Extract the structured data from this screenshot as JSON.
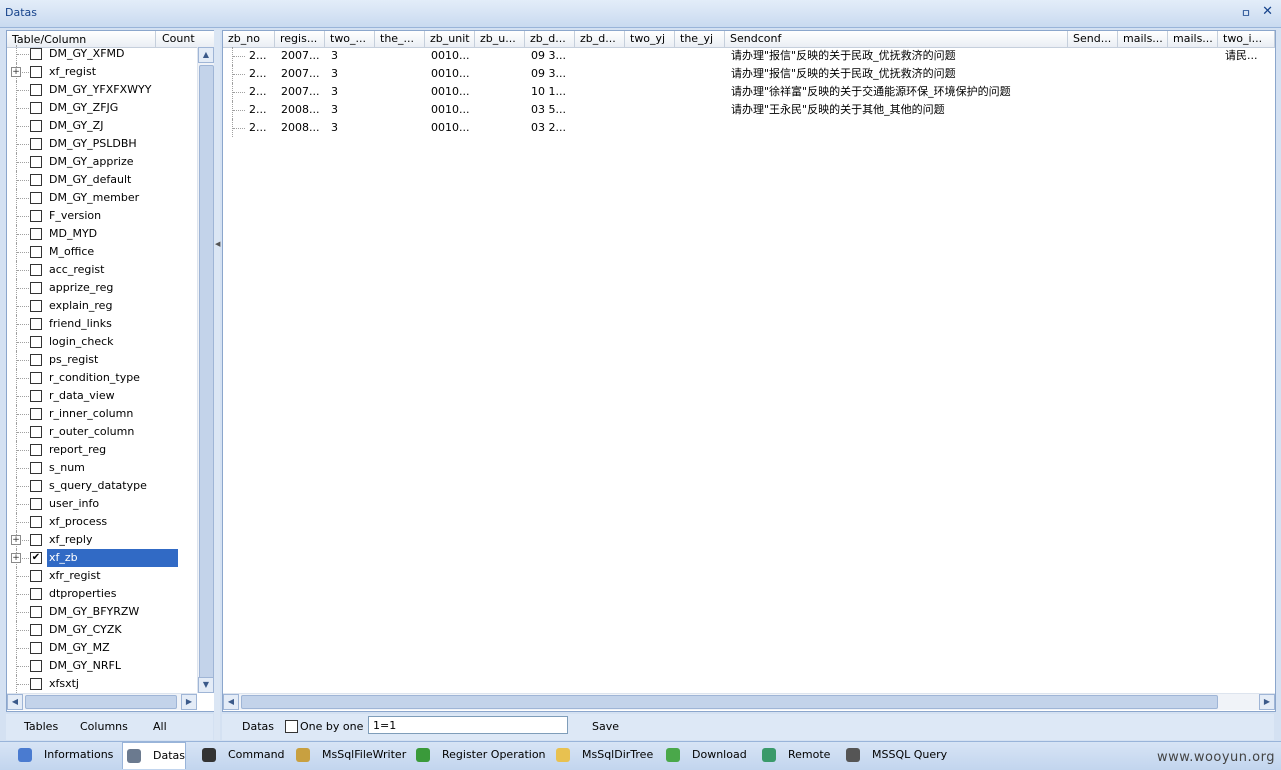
{
  "window": {
    "title": "Datas",
    "pin_glyph": "ㅁ",
    "close_glyph": "✕"
  },
  "tree": {
    "headers": [
      "Table/Column",
      "Count"
    ],
    "rows": [
      {
        "label": "DM_GY_XFMD",
        "checked": false,
        "expander": false
      },
      {
        "label": "xf_regist",
        "checked": false,
        "expander": true
      },
      {
        "label": "DM_GY_YFXFXWYY",
        "checked": false,
        "expander": false
      },
      {
        "label": "DM_GY_ZFJG",
        "checked": false,
        "expander": false
      },
      {
        "label": "DM_GY_ZJ",
        "checked": false,
        "expander": false
      },
      {
        "label": "DM_GY_PSLDBH",
        "checked": false,
        "expander": false
      },
      {
        "label": "DM_GY_apprize",
        "checked": false,
        "expander": false
      },
      {
        "label": "DM_GY_default",
        "checked": false,
        "expander": false
      },
      {
        "label": "DM_GY_member",
        "checked": false,
        "expander": false
      },
      {
        "label": "F_version",
        "checked": false,
        "expander": false
      },
      {
        "label": "MD_MYD",
        "checked": false,
        "expander": false
      },
      {
        "label": "M_office",
        "checked": false,
        "expander": false
      },
      {
        "label": "acc_regist",
        "checked": false,
        "expander": false
      },
      {
        "label": "apprize_reg",
        "checked": false,
        "expander": false
      },
      {
        "label": "explain_reg",
        "checked": false,
        "expander": false
      },
      {
        "label": "friend_links",
        "checked": false,
        "expander": false
      },
      {
        "label": "login_check",
        "checked": false,
        "expander": false
      },
      {
        "label": "ps_regist",
        "checked": false,
        "expander": false
      },
      {
        "label": "r_condition_type",
        "checked": false,
        "expander": false
      },
      {
        "label": "r_data_view",
        "checked": false,
        "expander": false
      },
      {
        "label": "r_inner_column",
        "checked": false,
        "expander": false
      },
      {
        "label": "r_outer_column",
        "checked": false,
        "expander": false
      },
      {
        "label": "report_reg",
        "checked": false,
        "expander": false
      },
      {
        "label": "s_num",
        "checked": false,
        "expander": false
      },
      {
        "label": "s_query_datatype",
        "checked": false,
        "expander": false
      },
      {
        "label": "user_info",
        "checked": false,
        "expander": false
      },
      {
        "label": "xf_process",
        "checked": false,
        "expander": false
      },
      {
        "label": "xf_reply",
        "checked": false,
        "expander": true
      },
      {
        "label": "xf_zb",
        "checked": true,
        "expander": true,
        "selected": true
      },
      {
        "label": "xfr_regist",
        "checked": false,
        "expander": false
      },
      {
        "label": "dtproperties",
        "checked": false,
        "expander": false
      },
      {
        "label": "DM_GY_BFYRZW",
        "checked": false,
        "expander": false
      },
      {
        "label": "DM_GY_CYZK",
        "checked": false,
        "expander": false
      },
      {
        "label": "DM_GY_MZ",
        "checked": false,
        "expander": false
      },
      {
        "label": "DM_GY_NRFL",
        "checked": false,
        "expander": false
      },
      {
        "label": "xfsxtj",
        "checked": false,
        "expander": false
      }
    ]
  },
  "grid": {
    "columns": [
      "zb_no",
      "regis...",
      "two_...",
      "the_...",
      "zb_unit",
      "zb_u...",
      "zb_d...",
      "zb_d...",
      "two_yj",
      "the_yj",
      "Sendconf",
      "Send...",
      "mails...",
      "mails...",
      "two_i..."
    ],
    "rows": [
      [
        "2...",
        "2007...",
        "3",
        "",
        "0010...",
        "",
        "09 3...",
        "",
        "",
        "",
        "请办理\"报信\"反映的关于民政_优抚救济的问题",
        "",
        "",
        "",
        "请民..."
      ],
      [
        "2...",
        "2007...",
        "3",
        "",
        "0010...",
        "",
        "09 3...",
        "",
        "",
        "",
        "请办理\"报信\"反映的关于民政_优抚救济的问题",
        "",
        "",
        "",
        ""
      ],
      [
        "2...",
        "2007...",
        "3",
        "",
        "0010...",
        "",
        "10 1...",
        "",
        "",
        "",
        "请办理\"徐祥富\"反映的关于交通能源环保_环境保护的问题",
        "",
        "",
        "",
        ""
      ],
      [
        "2...",
        "2008...",
        "3",
        "",
        "0010...",
        "",
        "03 5...",
        "",
        "",
        "",
        "请办理\"王永民\"反映的关于其他_其他的问题",
        "",
        "",
        "",
        ""
      ],
      [
        "2...",
        "2008...",
        "3",
        "",
        "0010...",
        "",
        "03 2...",
        "",
        "",
        "",
        "",
        "",
        "",
        "",
        ""
      ]
    ]
  },
  "left_tabs": [
    "Tables",
    "Columns",
    "All"
  ],
  "grid_toolbar": {
    "label": "Datas",
    "one_by_one": "One by one",
    "filter_value": "1=1",
    "save": "Save"
  },
  "bottom_tabs": [
    {
      "label": "Informations",
      "icon": "info-icon",
      "active": false
    },
    {
      "label": "Datas",
      "icon": "database-icon",
      "active": true
    },
    {
      "label": "Command",
      "icon": "terminal-icon",
      "active": false
    },
    {
      "label": "MsSqlFileWriter",
      "icon": "pencil-icon",
      "active": false
    },
    {
      "label": "Register Operation",
      "icon": "registry-icon",
      "active": false
    },
    {
      "label": "MsSqlDirTree",
      "icon": "folder-icon",
      "active": false
    },
    {
      "label": "Download",
      "icon": "download-icon",
      "active": false
    },
    {
      "label": "Remote",
      "icon": "globe-icon",
      "active": false
    },
    {
      "label": "MSSQL Query",
      "icon": "sql-icon",
      "active": false
    }
  ],
  "watermark": "www.wooyun.org",
  "colors": {
    "selection": "#316ac5",
    "accent": "#15428b"
  }
}
